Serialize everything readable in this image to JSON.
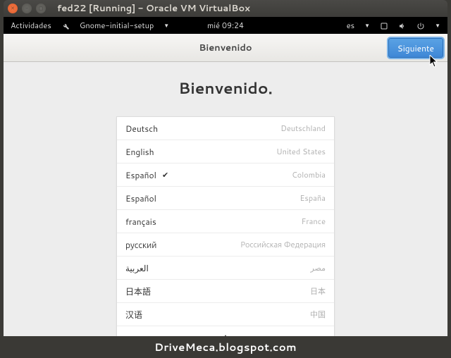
{
  "host": {
    "title": "fed22 [Running] - Oracle VM VirtualBox"
  },
  "gnome": {
    "activities": "Actividades",
    "app_indicator": "Gnome-initial-setup",
    "clock": "mié 09:24",
    "keyboard_layout": "es"
  },
  "header": {
    "title": "Bienvenido",
    "next_label": "Siguiente"
  },
  "welcome": {
    "title": "Bienvenido."
  },
  "languages": [
    {
      "name": "Deutsch",
      "country": "Deutschland",
      "selected": false
    },
    {
      "name": "English",
      "country": "United States",
      "selected": false
    },
    {
      "name": "Español",
      "country": "Colombia",
      "selected": true
    },
    {
      "name": "Español",
      "country": "España",
      "selected": false
    },
    {
      "name": "français",
      "country": "France",
      "selected": false
    },
    {
      "name": "русский",
      "country": "Российская Федерация",
      "selected": false
    },
    {
      "name": "العربية",
      "country": "مصر",
      "selected": false
    },
    {
      "name": "日本語",
      "country": "日本",
      "selected": false
    },
    {
      "name": "汉语",
      "country": "中国",
      "selected": false
    }
  ],
  "footer": {
    "watermark": "DriveMeca.blogspot.com"
  }
}
